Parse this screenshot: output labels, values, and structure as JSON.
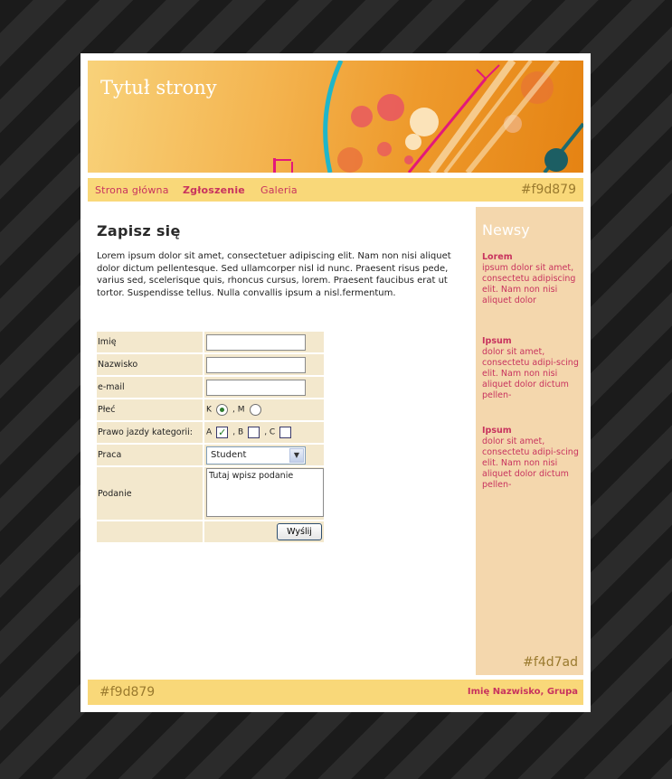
{
  "header": {
    "site_title": "Tytuł strony"
  },
  "nav": {
    "items": [
      {
        "label": "Strona główna"
      },
      {
        "label": "Zgłoszenie"
      },
      {
        "label": "Galeria"
      }
    ],
    "color_label": "#f9d879"
  },
  "main": {
    "heading": "Zapisz się",
    "intro": "Lorem ipsum dolor sit amet, consectetuer adipiscing elit. Nam non nisi aliquet dolor dictum pellentesque. Sed ullamcorper nisl id nunc. Praesent risus pede, varius sed, scelerisque quis, rhoncus cursus, lorem. Praesent faucibus erat ut tortor. Suspendisse tellus. Nulla convallis ipsum a nisl.fermentum."
  },
  "form": {
    "name_label": "Imię",
    "surname_label": "Nazwisko",
    "email_label": "e-mail",
    "gender_label": "Płeć",
    "gender_k": "K",
    "gender_m": ", M",
    "license_label": "Prawo jazdy kategorii:",
    "license_a": "A",
    "license_b": ", B",
    "license_c": ", C",
    "job_label": "Praca",
    "job_value": "Student",
    "application_label": "Podanie",
    "application_value": "Tutaj wpisz podanie",
    "submit_label": "Wyślij",
    "gender_selected": "K",
    "license_a_checked": true,
    "license_b_checked": false,
    "license_c_checked": false
  },
  "sidebar": {
    "title": "Newsy",
    "news": [
      {
        "title": "Lorem",
        "body": "ipsum dolor sit amet, consectetu adipiscing elit. Nam non nisi aliquet dolor"
      },
      {
        "title": "Ipsum",
        "body": "dolor sit amet, consectetu adipi-scing elit. Nam non nisi aliquet dolor dictum pellen-"
      },
      {
        "title": "Ipsum",
        "body": "dolor sit amet, consectetu adipi-scing elit. Nam non nisi aliquet dolor dictum pellen-"
      }
    ],
    "color_label": "#f4d7ad"
  },
  "footer": {
    "color_label": "#f9d879",
    "author": "Imię Nazwisko, Grupa"
  },
  "colors": {
    "nav_bg": "#f9d879",
    "sidebar_bg": "#f4d7ad",
    "link": "#c8335e",
    "form_cell": "#f3e8cd"
  }
}
